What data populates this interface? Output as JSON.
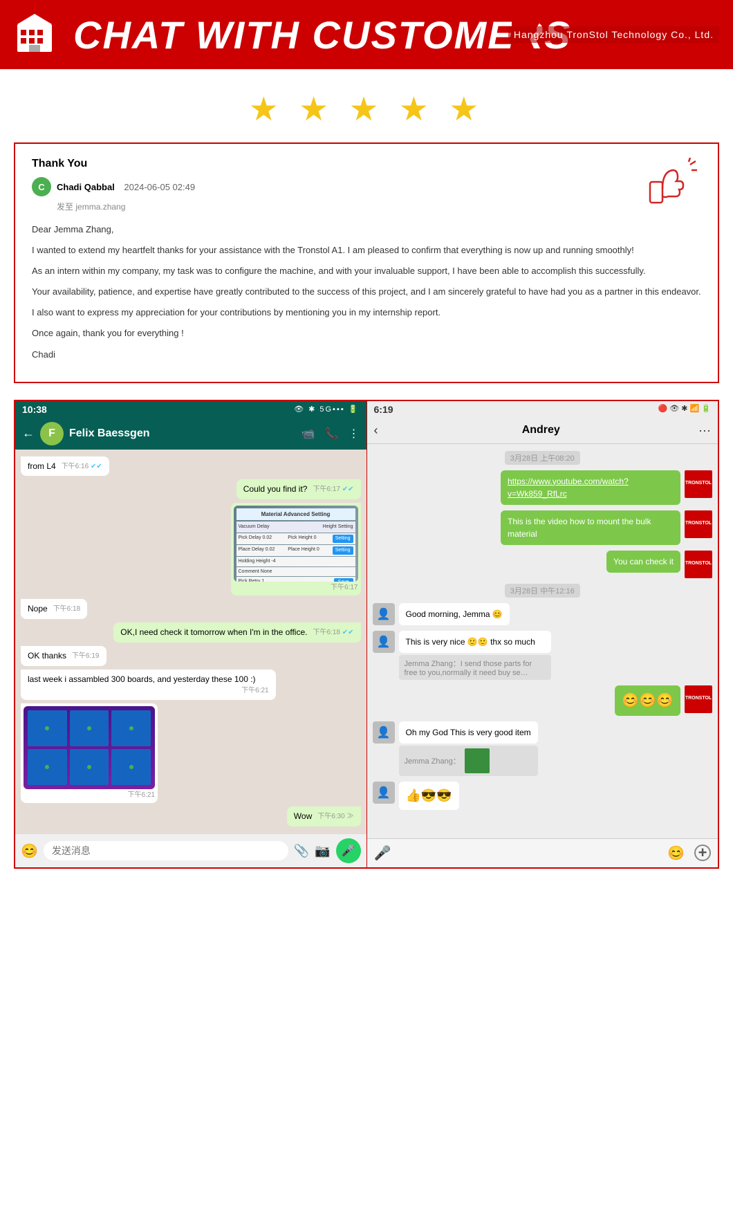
{
  "header": {
    "title": "CHAT WITH CUSTOMERS",
    "company": "Hangzhou TronStol Technology Co., Ltd.",
    "logo_letter": "🏢"
  },
  "stars": {
    "count": 5,
    "symbol": "★"
  },
  "thank_you_card": {
    "title": "Thank You",
    "sender": {
      "name": "Chadi Qabbal",
      "date": "2024-06-05 02:49",
      "to_label": "发至",
      "to_name": "jemma.zhang",
      "avatar_letter": "C"
    },
    "body_lines": [
      "Dear Jemma Zhang,",
      "I wanted to extend my heartfelt thanks for your assistance with the Tronstol A1. I am pleased to confirm that everything is now up and running smoothly!",
      "As an intern within my company, my task was to configure the machine, and with your invaluable support, I have been able to accomplish this successfully.",
      "Your availability, patience, and expertise have greatly contributed to the success of this project, and I am sincerely grateful to have had you as a partner in this endeavor.",
      "I also want to express my appreciation for your contributions by mentioning you in my internship report.",
      "Once again, thank you for everything !",
      "Chadi"
    ]
  },
  "chat_left": {
    "status_bar": {
      "time": "10:38",
      "icons": "👁 ✱ ⛃ 5G▪▪▪ 🔋"
    },
    "contact": {
      "name": "Felix Baessgen",
      "avatar_letter": "F"
    },
    "messages": [
      {
        "type": "received",
        "text": "from L4",
        "time": "下午6:16",
        "check": "✔✔"
      },
      {
        "type": "sent",
        "text": "Could you find it?",
        "time": "下午6:17",
        "check": "✔✔"
      },
      {
        "type": "sent_img",
        "label": "screenshot",
        "time": "下午6:17"
      },
      {
        "type": "received",
        "text": "Nope",
        "time": "下午6:18"
      },
      {
        "type": "sent",
        "text": "OK,I need check it tomorrow when I'm in the office.",
        "time": "下午6:18",
        "check": "✔✔"
      },
      {
        "type": "received",
        "text": "OK thanks",
        "time": "下午6:19"
      },
      {
        "type": "received",
        "text": "last week i assambled 300 boards, and yesterday these 100 :)",
        "time": "下午6:21"
      },
      {
        "type": "received_img",
        "label": "boards",
        "time": "下午6:21"
      },
      {
        "type": "sent",
        "text": "Wow",
        "time": "下午6:30"
      }
    ],
    "input": {
      "placeholder": "发送消息",
      "emoji": "😊",
      "mic": "🎤"
    }
  },
  "chat_right": {
    "status_bar": {
      "time": "6:19",
      "icons": "🔴🟥 👁 ✱ ⛃ 📶 🔋"
    },
    "contact": {
      "name": "Andrey"
    },
    "messages": [
      {
        "type": "date",
        "label": "3月28日 上午08:20"
      },
      {
        "type": "sent_green",
        "text_link": "https://www.youtube.com/watch?v=Wk859_RfLrc"
      },
      {
        "type": "sent_green",
        "text": "This is the video how to mount the bulk material"
      },
      {
        "type": "sent_green",
        "text": "You can check it"
      },
      {
        "type": "date",
        "label": "3月28日 中午12:16"
      },
      {
        "type": "received",
        "text": "Good morning, Jemma 😊"
      },
      {
        "type": "received",
        "text": "This is very nice 🙂🙂 thx so much"
      },
      {
        "type": "received_sub",
        "sub": "Jemma Zhang：I send those parts for free to you,normally it need buy se…"
      },
      {
        "type": "sent_emoji",
        "text": "😊😊😊"
      },
      {
        "type": "date2",
        "label": ""
      },
      {
        "type": "received",
        "text": "Oh my God This is very good item"
      },
      {
        "type": "received_sub2",
        "sub": "Jemma Zhang：[board image]"
      },
      {
        "type": "received",
        "text": "👍😎😎"
      }
    ],
    "input": {
      "voice_icon": "🎤",
      "emoji_icon": "😊",
      "add_icon": "+"
    }
  }
}
